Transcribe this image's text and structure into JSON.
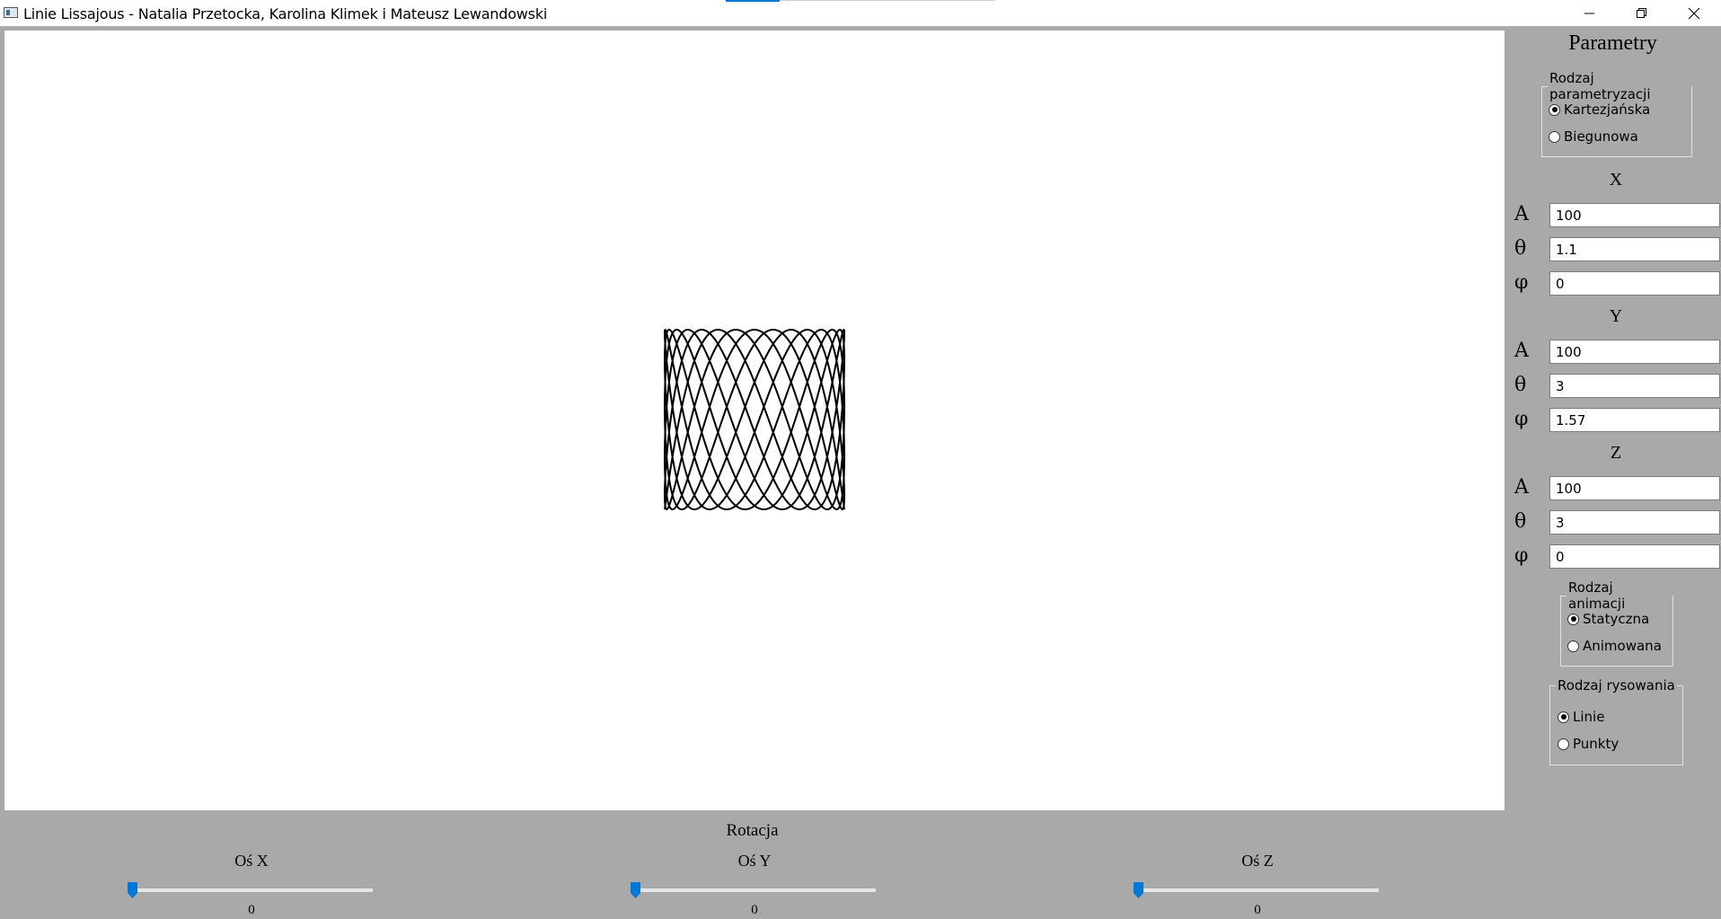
{
  "window": {
    "title": "Linie Lissajous - Natalia Przetocka, Karolina Klimek i Mateusz Lewandowski"
  },
  "panel": {
    "title": "Parametry",
    "parametrization": {
      "legend": "Rodzaj parametryzacji",
      "options": [
        "Kartezjańska",
        "Biegunowa"
      ],
      "selected": "Kartezjańska"
    },
    "x": {
      "heading": "X",
      "labels": {
        "A": "A",
        "theta": "θ",
        "phi": "φ"
      },
      "A": "100",
      "theta": "1.1",
      "phi": "0"
    },
    "y": {
      "heading": "Y",
      "labels": {
        "A": "A",
        "theta": "θ",
        "phi": "φ"
      },
      "A": "100",
      "theta": "3",
      "phi": "1.57"
    },
    "z": {
      "heading": "Z",
      "labels": {
        "A": "A",
        "theta": "θ",
        "phi": "φ"
      },
      "A": "100",
      "theta": "3",
      "phi": "0"
    },
    "animation": {
      "legend": "Rodzaj animacji",
      "options": [
        "Statyczna",
        "Animowana"
      ],
      "selected": "Statyczna"
    },
    "drawing": {
      "legend": "Rodzaj rysowania",
      "options": [
        "Linie",
        "Punkty"
      ],
      "selected": "Linie"
    }
  },
  "rotation": {
    "title": "Rotacja",
    "axes": [
      {
        "label": "Oś X",
        "value": "0"
      },
      {
        "label": "Oś Y",
        "value": "0"
      },
      {
        "label": "Oś Z",
        "value": "0"
      }
    ]
  },
  "colors": {
    "accent": "#0078d7",
    "panel_bg": "#a9a9a9",
    "canvas_bg": "#ffffff"
  },
  "icons": [
    "app-icon",
    "minimize-icon",
    "maximize-icon",
    "close-icon"
  ]
}
